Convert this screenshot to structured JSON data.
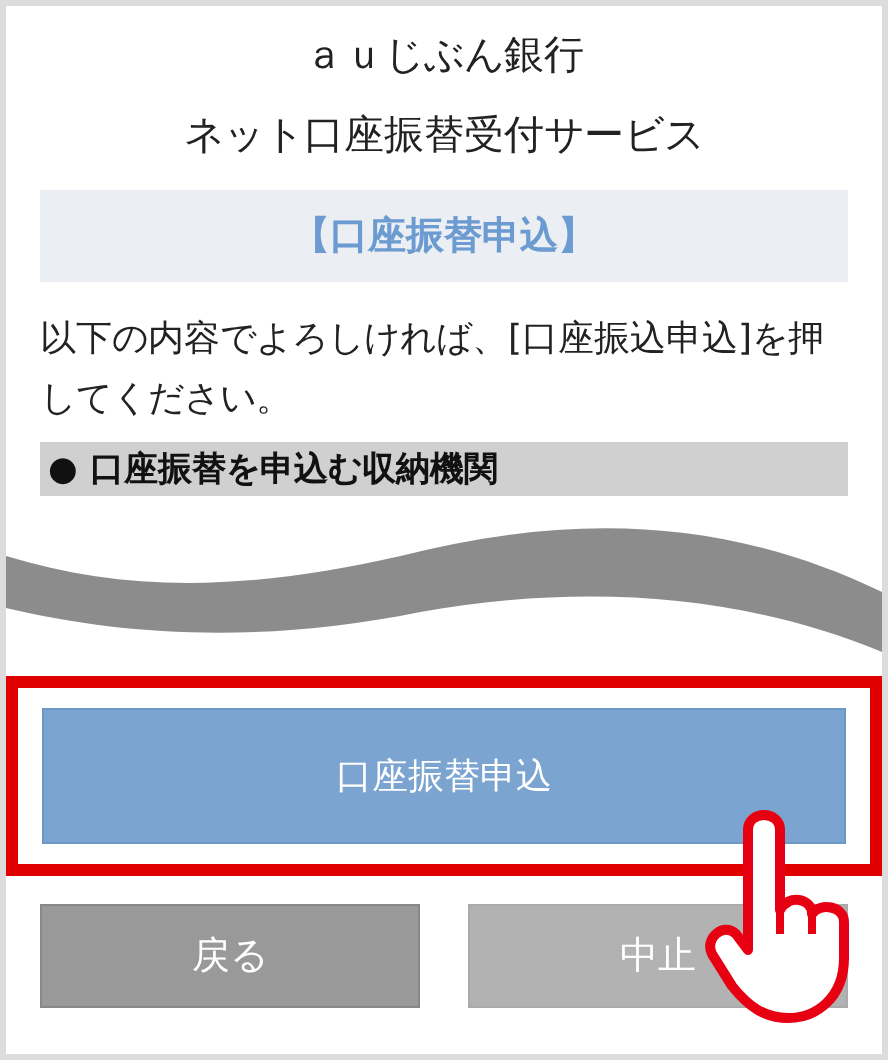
{
  "header": {
    "bank": "ａｕじぶん銀行",
    "service": "ネット口座振替受付サービス"
  },
  "banner": "【口座振替申込】",
  "instruction": "以下の内容でよろしければ、[口座振込申込]を押してください。",
  "section_heading": "● 口座振替を申込む収納機関",
  "primary_button": {
    "label": "口座振替申込",
    "highlighted": true
  },
  "buttons": [
    {
      "label": "戻る",
      "kind": "back"
    },
    {
      "label": "中止",
      "kind": "cancel"
    }
  ]
}
